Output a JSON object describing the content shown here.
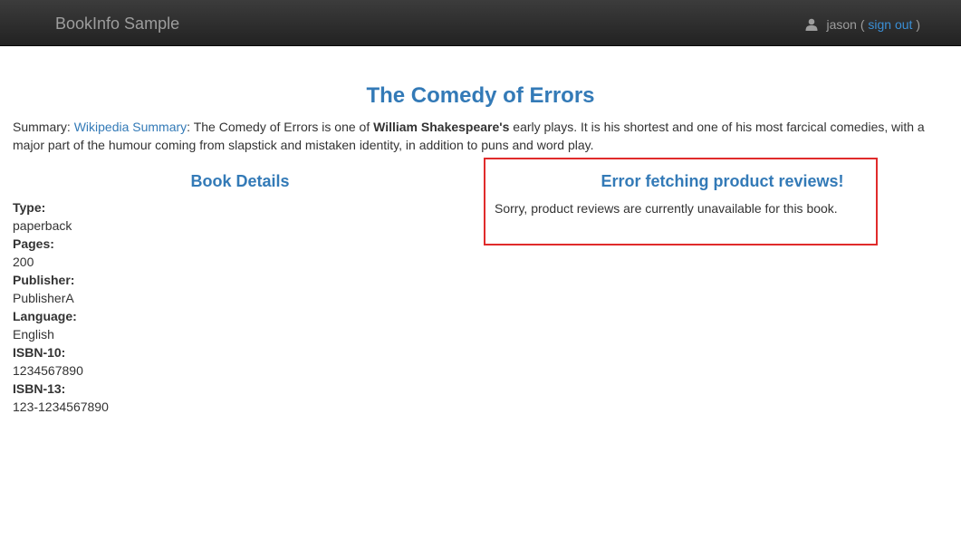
{
  "navbar": {
    "brand": "BookInfo Sample",
    "user_icon": "user-icon",
    "username": "jason",
    "open_paren": " ( ",
    "sign_out": "sign out",
    "close_paren": " )"
  },
  "book": {
    "title": "The Comedy of Errors",
    "summary_prefix": "Summary: ",
    "summary_link": "Wikipedia Summary",
    "summary_part1": ": The Comedy of Errors is one of ",
    "summary_bold": "William Shakespeare's",
    "summary_part2": " early plays. It is his shortest and one of his most farcical comedies, with a major part of the humour coming from slapstick and mistaken identity, in addition to puns and word play."
  },
  "details": {
    "heading": "Book Details",
    "items": [
      {
        "label": "Type:",
        "value": "paperback"
      },
      {
        "label": "Pages:",
        "value": "200"
      },
      {
        "label": "Publisher:",
        "value": "PublisherA"
      },
      {
        "label": "Language:",
        "value": "English"
      },
      {
        "label": "ISBN-10:",
        "value": "1234567890"
      },
      {
        "label": "ISBN-13:",
        "value": "123-1234567890"
      }
    ]
  },
  "reviews": {
    "heading": "Error fetching product reviews!",
    "message": "Sorry, product reviews are currently unavailable for this book."
  },
  "colors": {
    "link": "#337ab7",
    "error_border": "#e02b2b",
    "navbar_bg": "#222222"
  }
}
